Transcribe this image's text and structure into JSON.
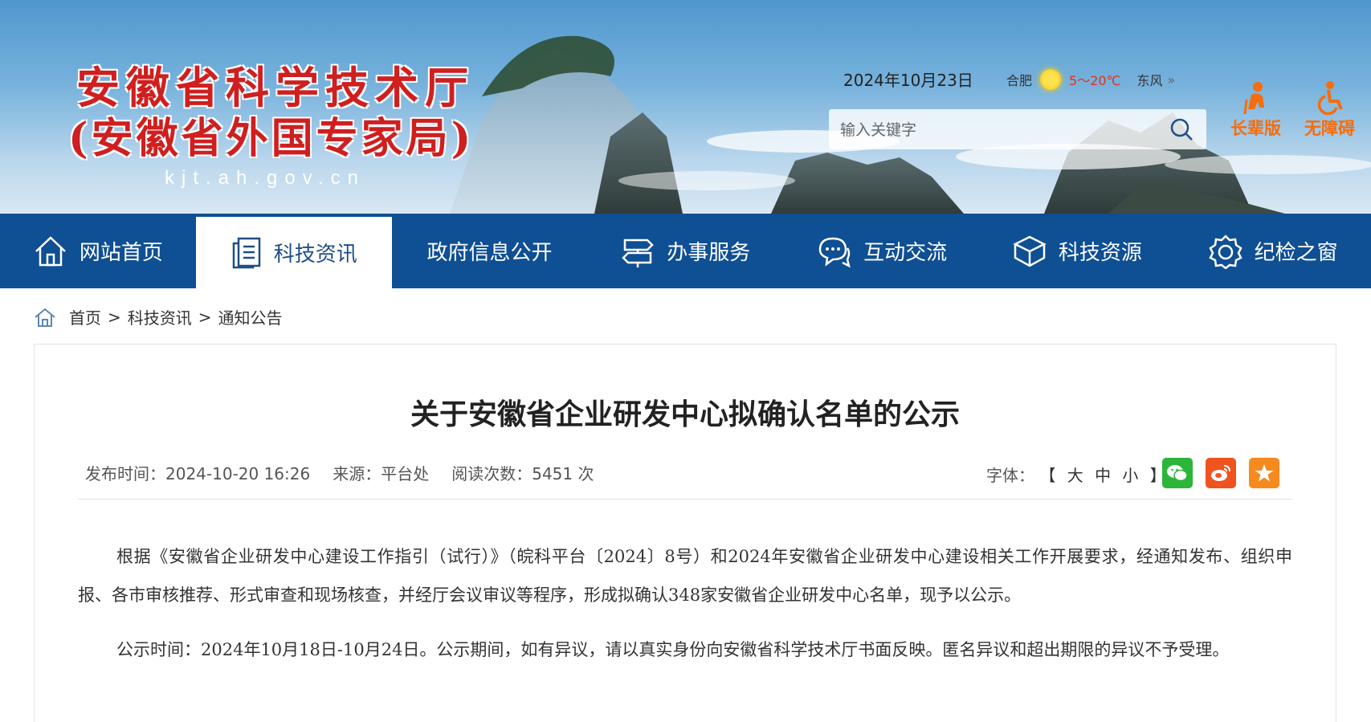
{
  "header": {
    "logo_line1": "安徽省科学技术厅",
    "logo_line2": "(安徽省外国专家局)",
    "logo_url": "kjt.ah.gov.cn",
    "date": "2024年10月23日",
    "weather": {
      "city": "合肥",
      "icon": "sun-icon",
      "temp": "5～20℃",
      "wind": "东风"
    },
    "search": {
      "placeholder": "输入关键字"
    },
    "elder_version": "长辈版",
    "accessibility": "无障碍"
  },
  "nav": [
    {
      "label": "网站首页",
      "icon": "home-icon"
    },
    {
      "label": "科技资讯",
      "icon": "document-icon",
      "active": true
    },
    {
      "label": "政府信息公开",
      "icon": ""
    },
    {
      "label": "办事服务",
      "icon": "signpost-icon"
    },
    {
      "label": "互动交流",
      "icon": "chat-icon"
    },
    {
      "label": "科技资源",
      "icon": "cube-icon"
    },
    {
      "label": "纪检之窗",
      "icon": "badge-icon"
    }
  ],
  "breadcrumb": {
    "home": "首页",
    "sep": ">",
    "level1": "科技资讯",
    "level2": "通知公告"
  },
  "article": {
    "title": "关于安徽省企业研发中心拟确认名单的公示",
    "publish_time": "发布时间：2024-10-20 16:26",
    "source": "来源：平台处",
    "views": "阅读次数：5451 次",
    "font_label": "字体：",
    "font_options": "【 大 中 小 】",
    "share": [
      "wechat-icon",
      "weibo-icon",
      "favorite-icon"
    ],
    "paragraphs": [
      "根据《安徽省企业研发中心建设工作指引（试行）》（皖科平台〔2024〕8号）和2024年安徽省企业研发中心建设相关工作开展要求，经通知发布、组织申报、各市审核推荐、形式审查和现场核查，并经厅会议审议等程序，形成拟确认348家安徽省企业研发中心名单，现予以公示。",
      "公示时间：2024年10月18日-10月24日。公示期间，如有异议，请以真实身份向安徽省科学技术厅书面反映。匿名异议和超出期限的异议不予受理。"
    ]
  },
  "colors": {
    "nav_bg": "#0f4f93",
    "logo_red": "#cf1f1f",
    "access_orange": "#f56d0e",
    "wechat": "#2cb53a",
    "weibo": "#f0531f",
    "favorite": "#f68a1f"
  }
}
